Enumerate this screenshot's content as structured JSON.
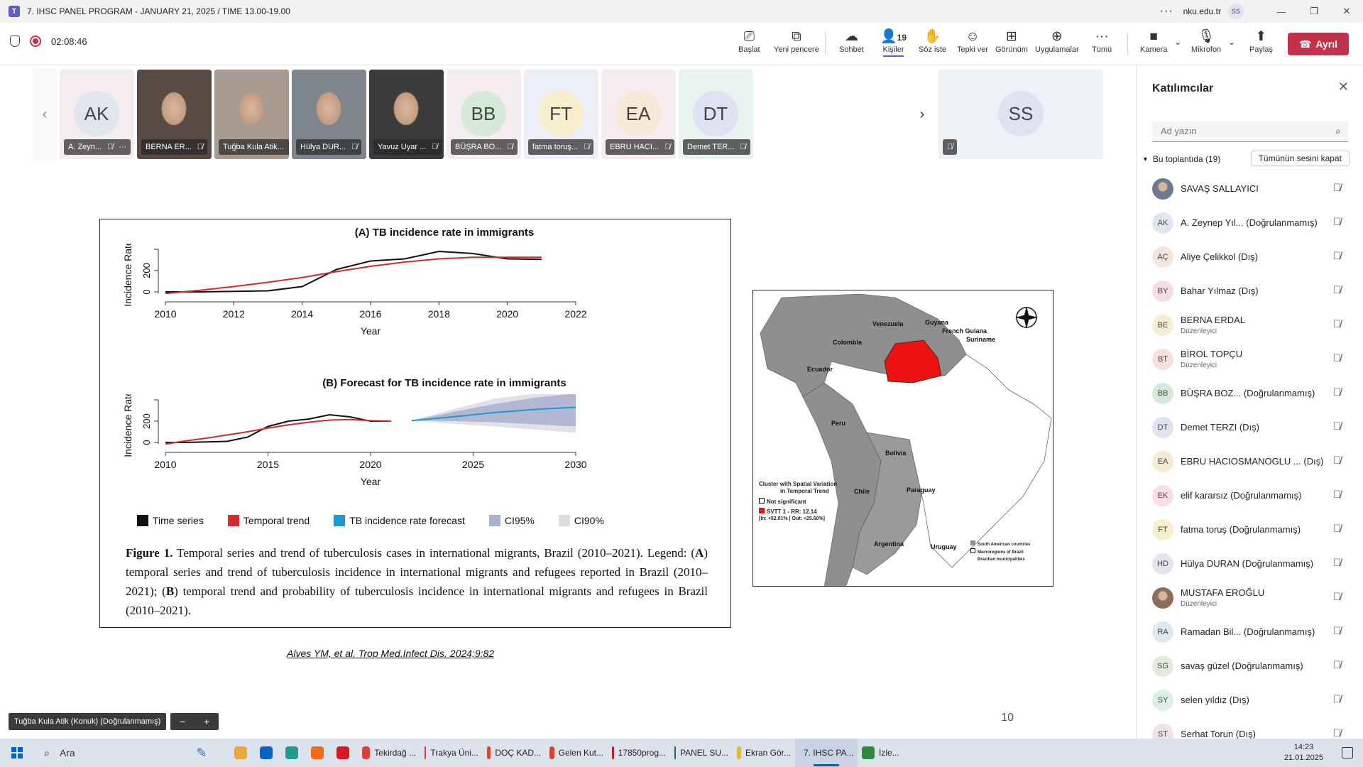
{
  "window": {
    "title": "7. IHSC PANEL PROGRAM - JANUARY 21, 2025 / TIME 13.00-19.00",
    "org": "nku.edu.tr",
    "user_initials": "SS"
  },
  "toolbar": {
    "timer": "02:08:46",
    "buttons": [
      {
        "label": "Başlat",
        "icon": "presenter-icon"
      },
      {
        "label": "Yeni pencere",
        "icon": "popout-icon"
      },
      {
        "label": "Sohbet",
        "icon": "chat-icon"
      },
      {
        "label": "Kişiler",
        "icon": "people-icon",
        "count": "19"
      },
      {
        "label": "Söz iste",
        "icon": "raise-hand-icon"
      },
      {
        "label": "Tepki ver",
        "icon": "react-icon"
      },
      {
        "label": "Görünüm",
        "icon": "view-icon"
      },
      {
        "label": "Uygulamalar",
        "icon": "apps-icon"
      },
      {
        "label": "Tümü",
        "icon": "more-icon"
      },
      {
        "label": "Kamera",
        "icon": "camera-off-icon"
      },
      {
        "label": "Mikrofon",
        "icon": "mic-off-icon"
      },
      {
        "label": "Paylaş",
        "icon": "share-icon"
      }
    ],
    "leave_label": "Ayrıl"
  },
  "strip": {
    "tiles": [
      {
        "initials": "AK",
        "name": "A. Zeyn...",
        "bg": "#f4ecee",
        "avatar_bg": "#dfe6ee",
        "more": "···"
      },
      {
        "initials": "",
        "name": "BERNA ER...",
        "photo": true,
        "bg": "#5a4a44"
      },
      {
        "initials": "",
        "name": "Tuğba Kula Atik...",
        "photo": true,
        "bg": "#a89a8f",
        "selected": true
      },
      {
        "initials": "",
        "name": "Hülya DUR...",
        "photo": true,
        "bg": "#7f858c"
      },
      {
        "initials": "",
        "name": "Yavuz Uyar ...",
        "photo": true,
        "bg": "#3b3b3b"
      },
      {
        "initials": "BB",
        "name": "BÜŞRA BO...",
        "bg": "#f4ecee",
        "avatar_bg": "#d7ead9"
      },
      {
        "initials": "FT",
        "name": "fatma toruş...",
        "bg": "#eceef8",
        "avatar_bg": "#f8efcf"
      },
      {
        "initials": "EA",
        "name": "EBRU HACI...",
        "bg": "#f6ecee",
        "avatar_bg": "#f7e9d6"
      },
      {
        "initials": "DT",
        "name": "Demet TER...",
        "bg": "#e9f3ef",
        "avatar_bg": "#dfe2f2"
      }
    ],
    "self_tile": {
      "initials": "SS"
    }
  },
  "slide": {
    "chart_a_title": "(A) TB incidence rate in immigrants",
    "chart_b_title": "(B) Forecast for TB incidence rate in immigrants",
    "legend": [
      {
        "label": "Time series",
        "color": "#111111"
      },
      {
        "label": "Temporal trend",
        "color": "#d42a2a"
      },
      {
        "label": "TB incidence rate forecast",
        "color": "#1c9ad6"
      },
      {
        "label": "CI95%",
        "color": "#a9b0cf"
      },
      {
        "label": "CI90%",
        "color": "#dcdde3"
      }
    ],
    "caption_lead": "Figure 1.",
    "caption_text_1": " Temporal series and trend of tuberculosis cases in international migrants, Brazil (2010–2021). Legend: (",
    "caption_a": "A",
    "caption_text_2": ") temporal series and trend of tuberculosis incidence in international migrants and refugees reported in Brazil (2010–2021); (",
    "caption_b": "B",
    "caption_text_3": ") temporal trend and probability of tuberculosis incidence in international migrants and refugees in Brazil (2010–2021).",
    "citation": "Alves YM, et al. Trop Med.Infect Dis. 2024;9:82",
    "page_number": "10",
    "map": {
      "countries": [
        "Venezuela",
        "Guyana",
        "French Guiana",
        "Suriname",
        "Colombia",
        "Ecuador",
        "Peru",
        "Bolivia",
        "Chile",
        "Paraguay",
        "Argentina",
        "Uruguay"
      ],
      "legend_title_1": "Cluster with Spatial Variation",
      "legend_title_2": "in Temporal Trend",
      "legend_not_sig": "Not significant",
      "legend_svtt": "SVTT 1 - RR: 12.14",
      "legend_svtt_detail": "[In: +52.01% | Out: +25.60%]",
      "legend_sa": "South American countries",
      "legend_macro": "Macroregions of Brazil",
      "legend_muni": "Brazilian municipalities"
    }
  },
  "chart_data": [
    {
      "type": "line",
      "title": "(A) TB incidence rate in immigrants",
      "xlabel": "Year",
      "ylabel": "Incidence Rate",
      "xlim": [
        2010,
        2022
      ],
      "xticks": [
        "2010",
        "2012",
        "2014",
        "2016",
        "2018",
        "2020",
        "2022"
      ],
      "yticks": [
        "0",
        "200"
      ],
      "ylim": [
        0,
        400
      ],
      "series": [
        {
          "name": "Time series",
          "color": "#111111",
          "x": [
            2010,
            2011,
            2012,
            2013,
            2014,
            2015,
            2016,
            2017,
            2018,
            2019,
            2020,
            2021
          ],
          "y": [
            0,
            0,
            5,
            10,
            50,
            210,
            290,
            310,
            380,
            360,
            310,
            305
          ]
        },
        {
          "name": "Temporal trend",
          "color": "#d42a2a",
          "x": [
            2010,
            2011,
            2012,
            2013,
            2014,
            2015,
            2016,
            2017,
            2018,
            2019,
            2020,
            2021
          ],
          "y": [
            -15,
            15,
            50,
            90,
            135,
            190,
            240,
            280,
            310,
            325,
            325,
            325
          ]
        }
      ]
    },
    {
      "type": "line",
      "title": "(B) Forecast for TB incidence rate in immigrants",
      "xlabel": "Year",
      "ylabel": "Incidence Rate",
      "xlim": [
        2010,
        2030
      ],
      "xticks": [
        "2010",
        "2015",
        "2020",
        "2025",
        "2030"
      ],
      "yticks": [
        "0",
        "200"
      ],
      "ylim": [
        0,
        400
      ],
      "series": [
        {
          "name": "Time series",
          "color": "#111111",
          "x": [
            2010,
            2011,
            2012,
            2013,
            2014,
            2015,
            2016,
            2017,
            2018,
            2019,
            2020,
            2021
          ],
          "y": [
            0,
            0,
            5,
            10,
            50,
            150,
            200,
            220,
            260,
            240,
            200,
            200
          ]
        },
        {
          "name": "Temporal trend",
          "color": "#d42a2a",
          "x": [
            2010,
            2011,
            2012,
            2013,
            2014,
            2015,
            2016,
            2017,
            2018,
            2019,
            2020,
            2021
          ],
          "y": [
            -15,
            15,
            40,
            70,
            100,
            135,
            165,
            190,
            210,
            215,
            205,
            200
          ]
        },
        {
          "name": "TB incidence rate forecast",
          "color": "#1c9ad6",
          "x": [
            2022,
            2024,
            2026,
            2028,
            2030
          ],
          "y": [
            205,
            240,
            280,
            310,
            330
          ]
        },
        {
          "name": "CI95%",
          "color": "#a9b0cf",
          "x": [
            2022,
            2024,
            2026,
            2028,
            2030
          ],
          "lower": [
            205,
            200,
            190,
            170,
            150
          ],
          "upper": [
            205,
            285,
            360,
            420,
            470
          ]
        },
        {
          "name": "CI90%",
          "color": "#dcdde3",
          "x": [
            2022,
            2024,
            2026,
            2028,
            2030
          ],
          "lower": [
            205,
            175,
            150,
            120,
            90
          ],
          "upper": [
            205,
            310,
            410,
            490,
            560
          ]
        }
      ]
    }
  ],
  "presenter": {
    "label": "Tuğba Kula Atik (Konuk) (Doğrulanmamış)"
  },
  "panel": {
    "title": "Katılımcılar",
    "search_placeholder": "Ad yazın",
    "section": "Bu toplantıda (19)",
    "mute_all": "Tümünün sesini kapat",
    "participants": [
      {
        "initials": "",
        "name": "SAVAŞ SALLAYICI",
        "photo": true,
        "bg": "#6e7b8e"
      },
      {
        "initials": "AK",
        "name": "A. Zeynep Yıl... (Doğrulanmamış)",
        "bg": "#dfe6ee"
      },
      {
        "initials": "AÇ",
        "name": "Aliye Çelikkol (Dış)",
        "bg": "#f6e4df"
      },
      {
        "initials": "BY",
        "name": "Bahar Yılmaz (Dış)",
        "bg": "#f4dde8"
      },
      {
        "initials": "BE",
        "name": "BERNA ERDAL",
        "role": "Düzenleyici",
        "bg": "#f8ecd3"
      },
      {
        "initials": "BT",
        "name": "BİROL TOPÇU",
        "role": "Düzenleyici",
        "bg": "#f6e0dc"
      },
      {
        "initials": "BB",
        "name": "BÜŞRA BOZ...  (Doğrulanmamış)",
        "bg": "#d7ead9"
      },
      {
        "initials": "DT",
        "name": "Demet TERZI (Dış)",
        "bg": "#dfe2f2"
      },
      {
        "initials": "EA",
        "name": "EBRU HACIOSMANOGLU ... (Dış)",
        "bg": "#f7e9d6"
      },
      {
        "initials": "EK",
        "name": "elif kararsız (Doğrulanmamış)",
        "bg": "#f7dfe2"
      },
      {
        "initials": "FT",
        "name": "fatma toruş (Doğrulanmamış)",
        "bg": "#f8efcf"
      },
      {
        "initials": "HD",
        "name": "Hülya DURAN (Doğrulanmamış)",
        "bg": "#e3e3f2"
      },
      {
        "initials": "",
        "name": "MUSTAFA EROĞLU",
        "role": "Düzenleyici",
        "photo": true,
        "bg": "#8a6f5a"
      },
      {
        "initials": "RA",
        "name": "Ramadan Bil...  (Doğrulanmamış)",
        "bg": "#dde8f3"
      },
      {
        "initials": "SG",
        "name": "savaş güzel (Doğrulanmamış)",
        "bg": "#e3ecdc"
      },
      {
        "initials": "SY",
        "name": "selen yıldız (Dış)",
        "bg": "#dcefe3"
      },
      {
        "initials": "ST",
        "name": "Serhat Torun (Dış)",
        "bg": "#efe3e7"
      }
    ]
  },
  "taskbar": {
    "search": "Ara",
    "apps": [
      {
        "label": "",
        "icon": "file-explorer-icon",
        "color": "#e8a83c"
      },
      {
        "label": "",
        "icon": "outlook-icon",
        "color": "#0a64c8"
      },
      {
        "label": "",
        "icon": "edge-icon",
        "color": "#1f9c8f"
      },
      {
        "label": "",
        "icon": "firefox-icon",
        "color": "#f06b1d"
      },
      {
        "label": "",
        "icon": "opera-icon",
        "color": "#d81b23"
      },
      {
        "label": "Tekirdağ ...",
        "icon": "chrome-icon",
        "color": "#d9432f"
      },
      {
        "label": "Trakya Üni...",
        "icon": "chrome-icon",
        "color": "#d9432f"
      },
      {
        "label": "DOÇ KAD...",
        "icon": "chrome-icon",
        "color": "#d9432f"
      },
      {
        "label": "Gelen Kut...",
        "icon": "chrome-icon",
        "color": "#d9432f"
      },
      {
        "label": "17850prog...",
        "icon": "pdf-icon",
        "color": "#c4231b"
      },
      {
        "label": "PANEL SU...",
        "icon": "excel-icon",
        "color": "#1d7044"
      },
      {
        "label": "Ekran Gör...",
        "icon": "folder-icon",
        "color": "#e8b53c"
      },
      {
        "label": "7. IHSC PA...",
        "icon": "teams-icon",
        "color": "#5b5fc7",
        "active": true
      },
      {
        "label": "İzle...",
        "icon": "watch-icon",
        "color": "#2b8a3e"
      }
    ],
    "time": "14:23",
    "date": "21.01.2025"
  }
}
